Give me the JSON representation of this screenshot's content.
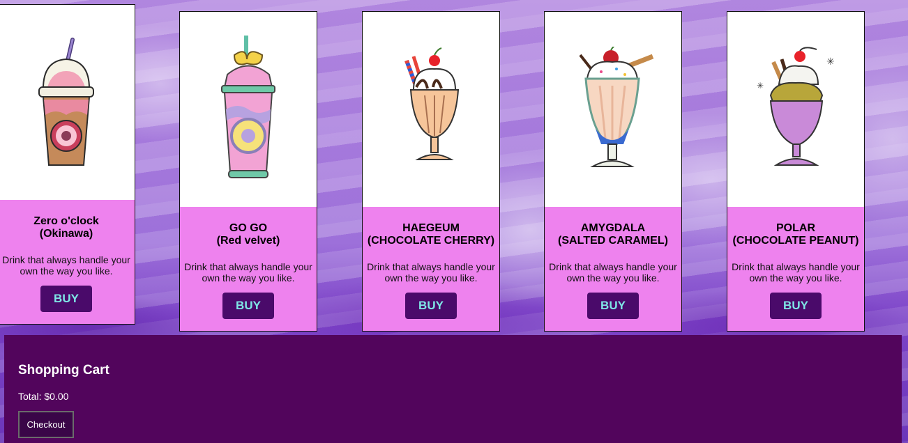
{
  "products": [
    {
      "name_line1": "Zero o'clock",
      "name_line2": "(Okinawa)",
      "description": "Drink that always handle your own the way you like.",
      "buy_label": "BUY",
      "icon": "bubble-tea-cup-icon"
    },
    {
      "name_line1": "GO GO",
      "name_line2": "(Red velvet)",
      "description": "Drink that always handle your own the way you like.",
      "buy_label": "BUY",
      "icon": "tumbler-drink-icon"
    },
    {
      "name_line1": "HAEGEUM",
      "name_line2": "(CHOCOLATE CHERRY)",
      "description": "Drink that always handle your own the way you like.",
      "buy_label": "BUY",
      "icon": "sundae-glass-icon"
    },
    {
      "name_line1": "AMYGDALA",
      "name_line2": "(SALTED CARAMEL)",
      "description": "Drink that always handle your own the way you like.",
      "buy_label": "BUY",
      "icon": "milkshake-glass-icon"
    },
    {
      "name_line1": "POLAR",
      "name_line2": "(CHOCOLATE PEANUT)",
      "description": "Drink that always handle your own the way you like.",
      "buy_label": "BUY",
      "icon": "freakshake-icon"
    }
  ],
  "cart": {
    "title": "Shopping Cart",
    "total_label": "Total: $0.00",
    "checkout_label": "Checkout"
  },
  "colors": {
    "card_bg": "#ee82ee",
    "buy_bg": "#4a0a6a",
    "buy_text": "#7fe6e6",
    "cart_bg": "#52055c"
  }
}
